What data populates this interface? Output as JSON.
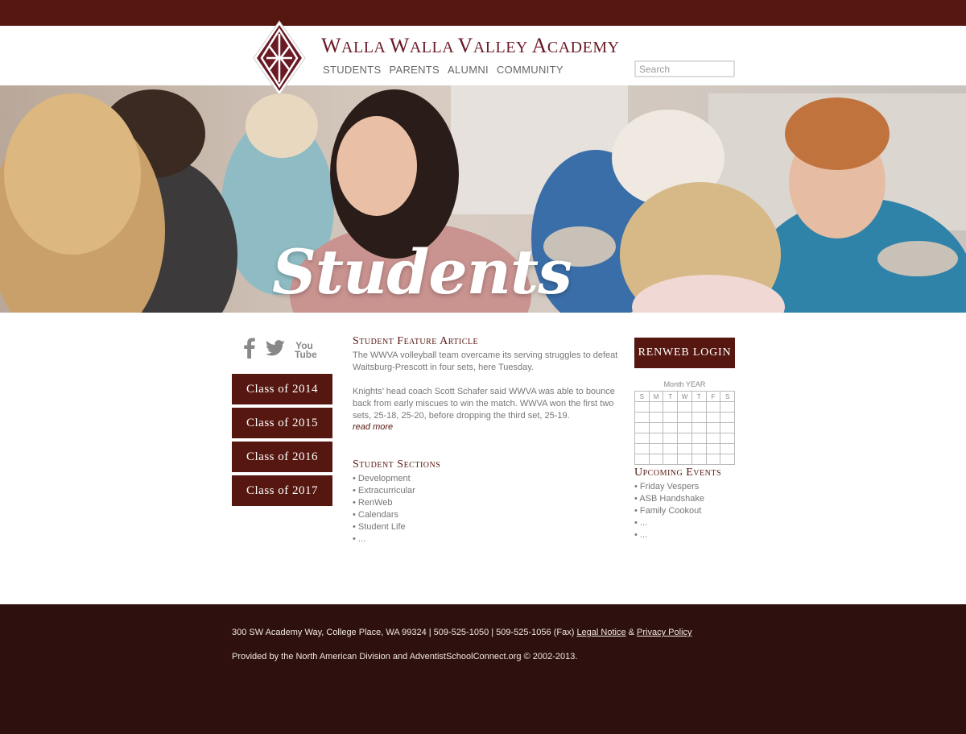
{
  "colors": {
    "brand": "#561710",
    "footer": "#2e110e",
    "title": "#6a1a25"
  },
  "header": {
    "title_parts": [
      "W",
      "alla ",
      "W",
      "alla ",
      "V",
      "alley ",
      "A",
      "cademy"
    ],
    "nav": [
      "STUDENTS",
      "PARENTS",
      "ALUMNI",
      "COMMUNITY"
    ],
    "search_placeholder": "Search"
  },
  "hero": {
    "title": "Students"
  },
  "sidebar": {
    "social": {
      "youtube_top": "You",
      "youtube_bottom": "Tube"
    },
    "classes": [
      "Class of 2014",
      "Class of 2015",
      "Class of 2016",
      "Class of 2017"
    ]
  },
  "article": {
    "title": "Student Feature Article",
    "p1": "The WWVA volleyball team overcame its serving struggles to defeat Waitsburg-Prescott in four sets, here Tuesday.",
    "p2": "Knights’ head coach Scott Schafer said WWVA was able to bounce back from early miscues to win the match. WWVA won the first two sets, 25-18, 25-20, before dropping the third set, 25-19.",
    "read_more": "read more"
  },
  "sections": {
    "title": "Student Sections",
    "items": [
      "Development",
      "Extracurricular",
      "RenWeb",
      "Calendars",
      "Student Life",
      "..."
    ]
  },
  "right": {
    "renweb": "RENWEB LOGIN",
    "calendar_title": "Month YEAR",
    "weekdays": [
      "S",
      "M",
      "T",
      "W",
      "T",
      "F",
      "S"
    ],
    "events_title": "Upcoming Events",
    "events": [
      "Friday Vespers",
      "ASB Handshake",
      "Family Cookout",
      "...",
      "..."
    ]
  },
  "footer": {
    "address": "300 SW Academy Way, College Place, WA 99324 | 509-525-1050 | 509-525-1056 (Fax) ",
    "legal": "Legal Notice",
    "amp": " & ",
    "privacy": "Privacy Policy",
    "provided": "Provided by the North American Division and AdventistSchoolConnect.org © 2002-2013."
  }
}
